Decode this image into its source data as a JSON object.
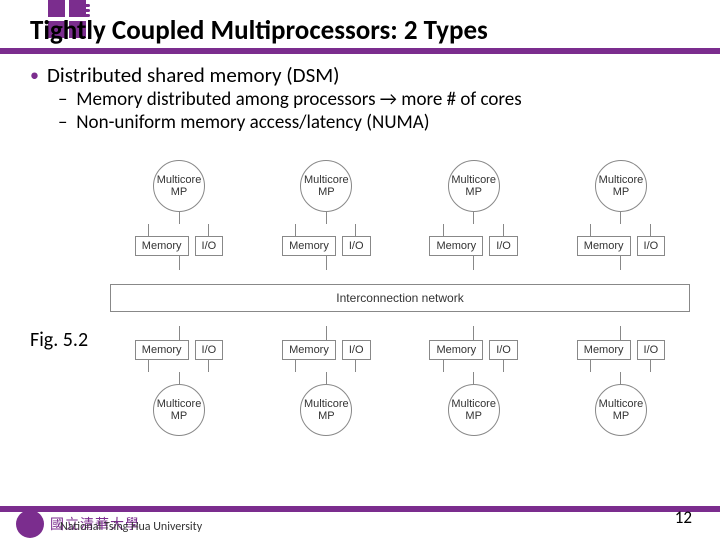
{
  "title": "Tightly Coupled Multiprocessors: 2 Types",
  "bullets": {
    "main": "Distributed shared memory (DSM)",
    "sub1": "Memory distributed among processors → more # of cores",
    "sub2": "Non-uniform memory access/latency (NUMA)"
  },
  "fig_label": "Fig. 5.2",
  "diagram": {
    "node_label_line1": "Multicore",
    "node_label_line2": "MP",
    "mem_label": "Memory",
    "io_label": "I/O",
    "interconnect": "Interconnection network"
  },
  "footer": {
    "cn": "國立清華大學",
    "en": "National Tsing Hua University"
  },
  "page": "12"
}
